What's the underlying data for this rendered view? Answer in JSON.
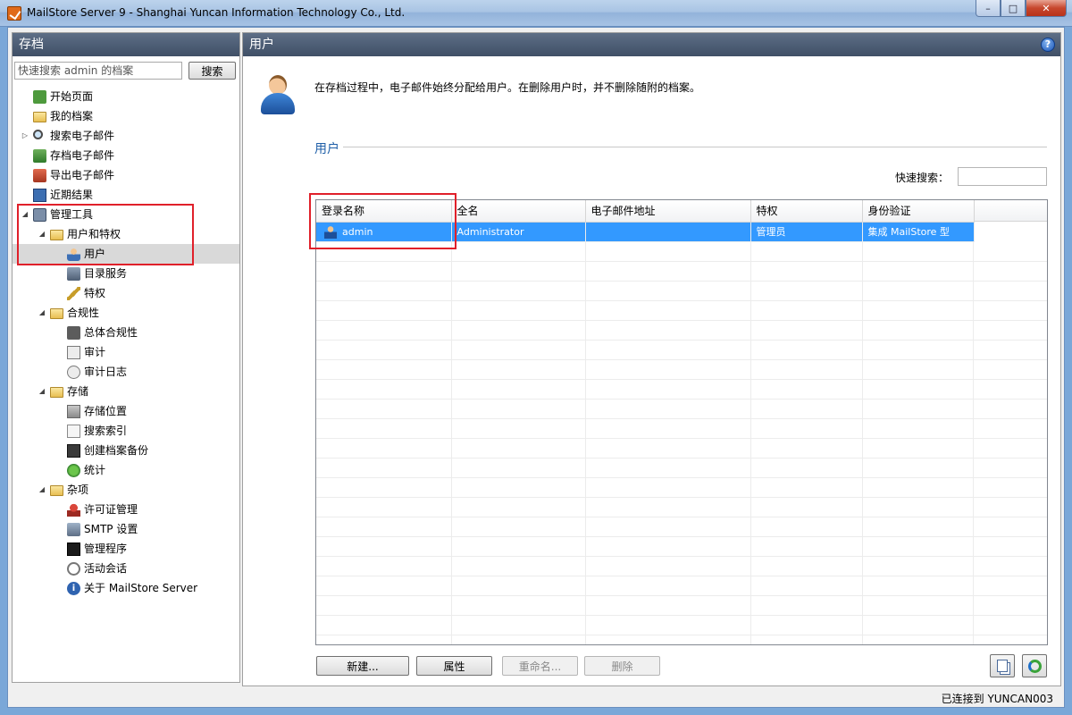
{
  "window": {
    "title": "MailStore Server 9 - Shanghai Yuncan Information Technology Co., Ltd.",
    "min_glyph": "–",
    "max_glyph": "□",
    "close_glyph": "✕"
  },
  "left_panel": {
    "header": "存档",
    "search_placeholder": "快速搜索 admin 的档案",
    "search_button": "搜索",
    "tree": [
      {
        "label": "开始页面",
        "icon": "home-icon",
        "level": 0
      },
      {
        "label": "我的档案",
        "icon": "folder-icon",
        "level": 0
      },
      {
        "label": "搜索电子邮件",
        "icon": "search-icon",
        "level": 0,
        "expander": "▷"
      },
      {
        "label": "存档电子邮件",
        "icon": "archive-email-icon",
        "level": 0
      },
      {
        "label": "导出电子邮件",
        "icon": "export-email-icon",
        "level": 0
      },
      {
        "label": "近期结果",
        "icon": "recent-results-icon",
        "level": 0
      },
      {
        "label": "管理工具",
        "icon": "admin-tools-icon",
        "level": 0,
        "expander": "◢"
      },
      {
        "label": "用户和特权",
        "icon": "folder-icon",
        "level": 1,
        "expander": "◢"
      },
      {
        "label": "用户",
        "icon": "user-icon",
        "level": 2,
        "selected": true
      },
      {
        "label": "目录服务",
        "icon": "directory-services-icon",
        "level": 2
      },
      {
        "label": "特权",
        "icon": "key-icon",
        "level": 2
      },
      {
        "label": "合规性",
        "icon": "folder-icon",
        "level": 1,
        "expander": "◢"
      },
      {
        "label": "总体合规性",
        "icon": "compliance-icon",
        "level": 2
      },
      {
        "label": "审计",
        "icon": "audit-icon",
        "level": 2
      },
      {
        "label": "审计日志",
        "icon": "audit-log-icon",
        "level": 2
      },
      {
        "label": "存储",
        "icon": "folder-icon",
        "level": 1,
        "expander": "◢"
      },
      {
        "label": "存储位置",
        "icon": "storage-locations-icon",
        "level": 2
      },
      {
        "label": "搜索索引",
        "icon": "search-index-icon",
        "level": 2
      },
      {
        "label": "创建档案备份",
        "icon": "backup-icon",
        "level": 2
      },
      {
        "label": "统计",
        "icon": "statistics-icon",
        "level": 2
      },
      {
        "label": "杂项",
        "icon": "folder-icon",
        "level": 1,
        "expander": "◢"
      },
      {
        "label": "许可证管理",
        "icon": "license-icon",
        "level": 2
      },
      {
        "label": "SMTP 设置",
        "icon": "smtp-icon",
        "level": 2
      },
      {
        "label": "管理程序",
        "icon": "console-icon",
        "level": 2
      },
      {
        "label": "活动会话",
        "icon": "sessions-icon",
        "level": 2
      },
      {
        "label": "关于 MailStore Server",
        "icon": "info-icon",
        "level": 2
      }
    ]
  },
  "right_panel": {
    "header": "用户",
    "help_glyph": "?",
    "description": "在存档过程中，电子邮件始终分配给用户。在删除用户时，并不删除随附的档案。",
    "section_title": "用户",
    "quick_search_label": "快速搜索：",
    "columns": [
      "登录名称",
      "全名",
      "电子邮件地址",
      "特权",
      "身份验证"
    ],
    "rows": [
      {
        "login": "admin",
        "fullname": "Administrator",
        "email": "",
        "privilege": "管理员",
        "auth": "集成 MailStore 型"
      }
    ],
    "buttons": {
      "new": "新建...",
      "properties": "属性",
      "rename": "重命名...",
      "delete": "删除"
    }
  },
  "status_bar": {
    "text": "已连接到 YUNCAN003"
  }
}
